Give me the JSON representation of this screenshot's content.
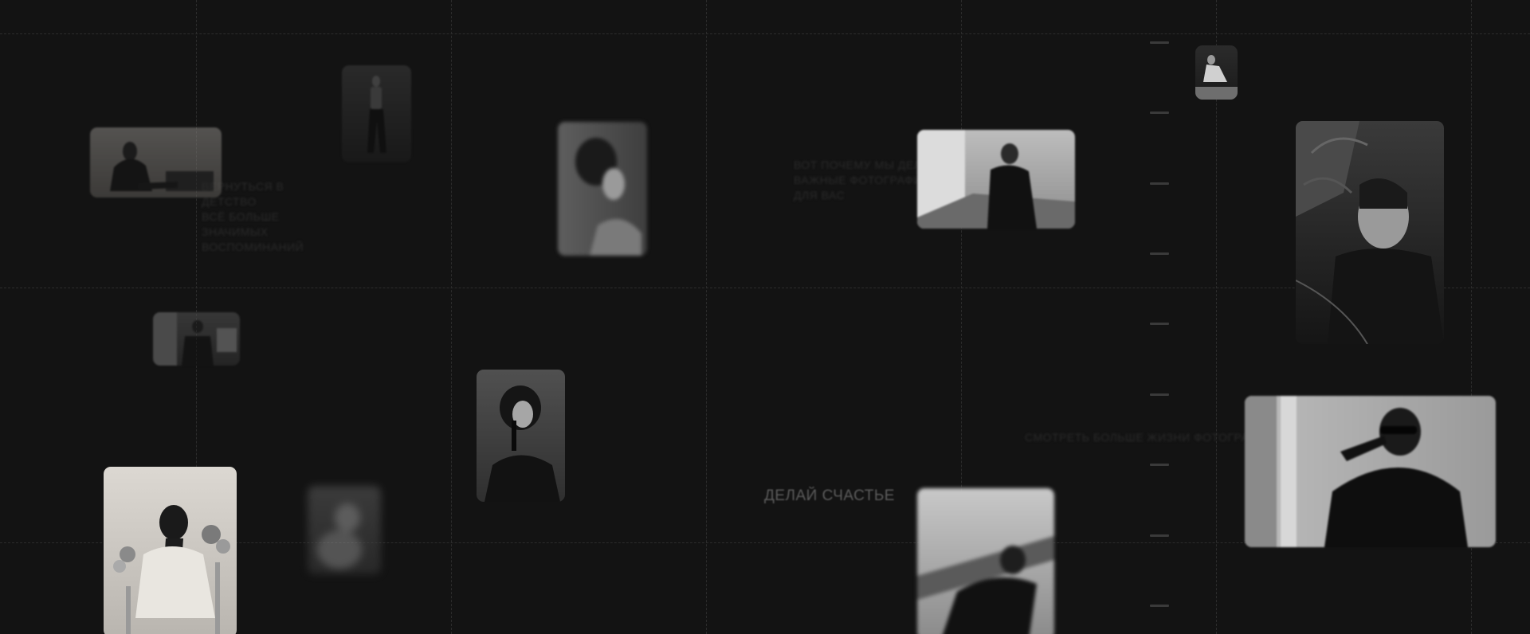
{
  "background_color": "#131313",
  "grid_line_color": "#2c2c2c",
  "slogan": "ДЕЛАЙ СЧАСТЬЕ",
  "faint_text_blocks": [
    [
      "ВЕРНУТЬСЯ В",
      "ДЕТСТВО",
      "ВСЁ БОЛЬШЕ",
      "ЗНАЧИМЫХ",
      "ВОСПОМИНАНИЙ"
    ],
    [
      "ВОТ ПОЧЕМУ МЫ ДЕЛАЕМ",
      "ВАЖНЫЕ ФОТОГРАФИИ",
      "ДЛЯ ВАС"
    ],
    [
      "СМОТРЕТЬ БОЛЬШЕ ЖИЗНИ ФОТОГРАФИЙ"
    ]
  ],
  "photos": [
    {
      "name": "portrait-seated-woman-sofa"
    },
    {
      "name": "portrait-standing-woman"
    },
    {
      "name": "portrait-profile-woman"
    },
    {
      "name": "portrait-woman-city-railing"
    },
    {
      "name": "portrait-crouching-woman"
    },
    {
      "name": "portrait-woman-plants"
    },
    {
      "name": "portrait-woman-office"
    },
    {
      "name": "portrait-woman-curly-hair"
    },
    {
      "name": "portrait-woman-sunglasses"
    },
    {
      "name": "portrait-woman-flowers"
    },
    {
      "name": "portrait-blurred-figure"
    },
    {
      "name": "portrait-woman-lying"
    }
  ]
}
